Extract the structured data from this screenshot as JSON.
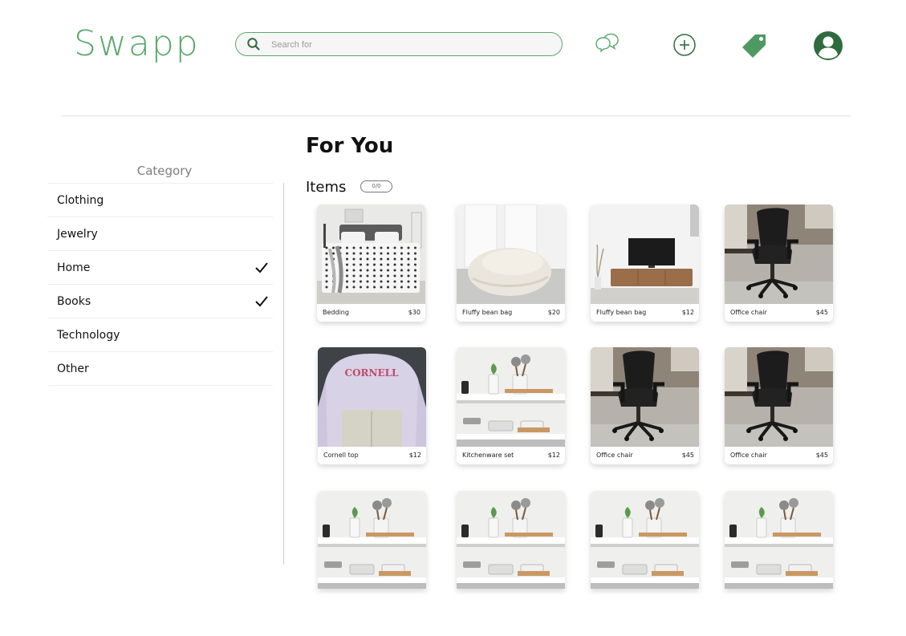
{
  "app": {
    "logo": "Swapp",
    "accent": "#5aa96d"
  },
  "header": {
    "search_placeholder": "Search for",
    "icons": [
      "search-icon",
      "messages-icon",
      "add-listing-icon",
      "tag-icon",
      "profile-icon"
    ]
  },
  "sidebar": {
    "title": "Category",
    "items": [
      {
        "label": "Clothing",
        "checked": false
      },
      {
        "label": "Jewelry",
        "checked": false
      },
      {
        "label": "Home",
        "checked": true
      },
      {
        "label": "Books",
        "checked": true
      },
      {
        "label": "Technology",
        "checked": false
      },
      {
        "label": "Other",
        "checked": false
      }
    ]
  },
  "main": {
    "title": "For You",
    "items_label": "Items",
    "items_badge": "0/0",
    "cards": [
      {
        "name": "Bedding",
        "price": "$30",
        "image": "bedding"
      },
      {
        "name": "Fluffy bean bag",
        "price": "$20",
        "image": "beanbag"
      },
      {
        "name": "Fluffy bean bag",
        "price": "$12",
        "image": "tv-stand"
      },
      {
        "name": "Office chair",
        "price": "$45",
        "image": "office-chair"
      },
      {
        "name": "Cornell top",
        "price": "$12",
        "image": "sweatshirt"
      },
      {
        "name": "Kitchenware set",
        "price": "$12",
        "image": "kitchenware"
      },
      {
        "name": "Office chair",
        "price": "$45",
        "image": "office-chair"
      },
      {
        "name": "Office chair",
        "price": "$45",
        "image": "office-chair"
      },
      {
        "name": "",
        "price": "",
        "image": "kitchenware"
      },
      {
        "name": "",
        "price": "",
        "image": "kitchenware"
      },
      {
        "name": "",
        "price": "",
        "image": "kitchenware"
      },
      {
        "name": "",
        "price": "",
        "image": "kitchenware"
      }
    ],
    "sweatshirt_text": "CORNELL"
  }
}
